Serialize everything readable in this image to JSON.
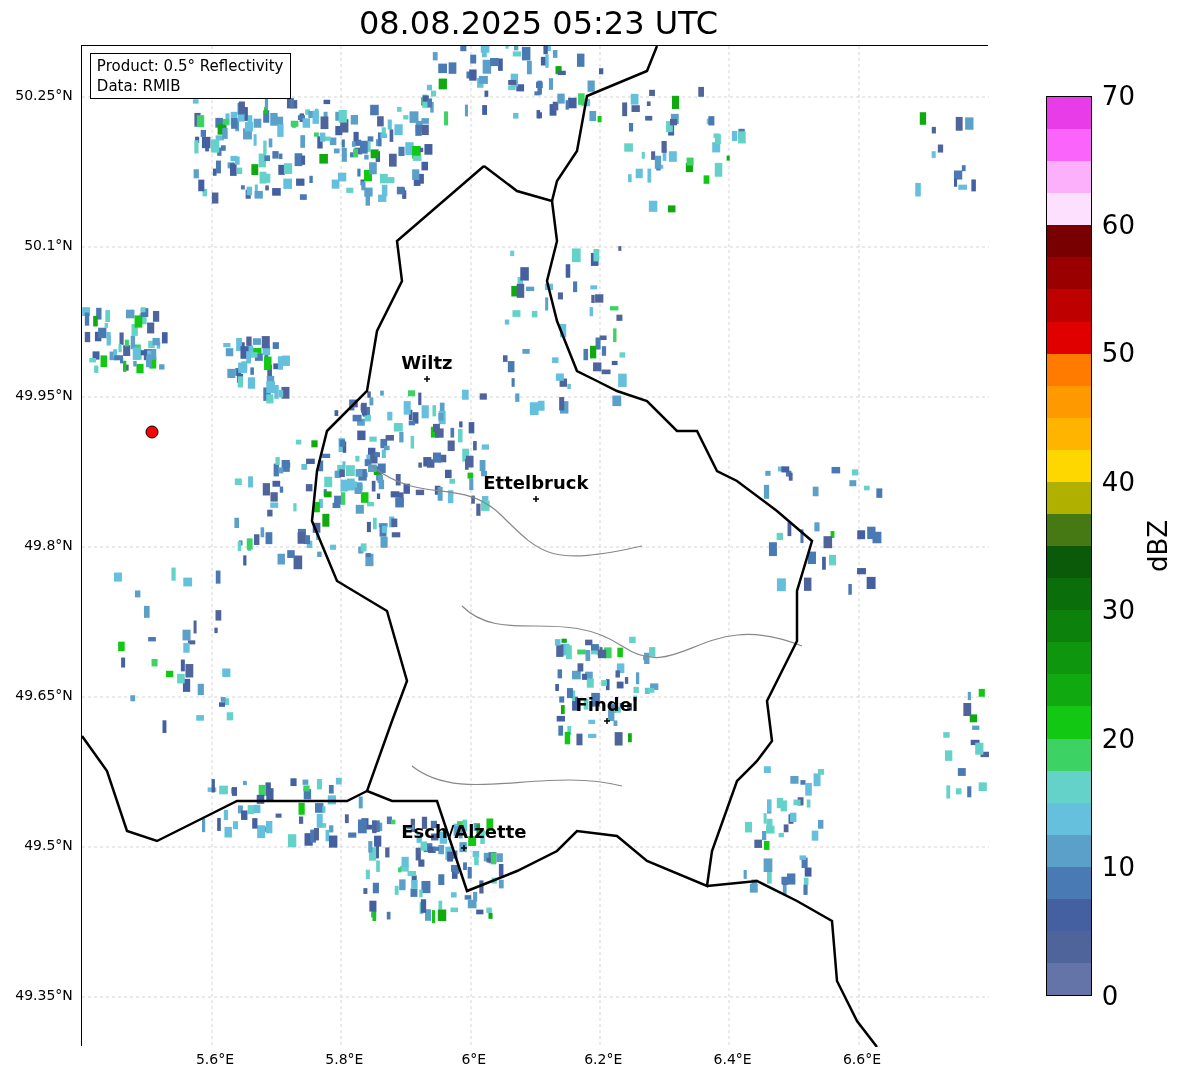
{
  "title": "08.08.2025 05:23 UTC",
  "info_box": [
    "Product: 0.5° Reflectivity",
    "Data: RMIB"
  ],
  "y_ticks": [
    "50.25°N",
    "50.1°N",
    "49.95°N",
    "49.8°N",
    "49.65°N",
    "49.5°N",
    "49.35°N"
  ],
  "x_ticks": [
    "5.6°E",
    "5.8°E",
    "6°E",
    "6.2°E",
    "6.4°E",
    "6.6°E"
  ],
  "cities": [
    {
      "name": "Wiltz"
    },
    {
      "name": "Ettelbruck"
    },
    {
      "name": "Findel"
    },
    {
      "name": "Esch/Alzette"
    }
  ],
  "colorbar": {
    "label": "dBZ",
    "ticks": [
      "70",
      "60",
      "50",
      "40",
      "30",
      "20",
      "10",
      "0"
    ],
    "segments": [
      {
        "color": "#e93ce9"
      },
      {
        "color": "#fa64fa"
      },
      {
        "color": "#fcb0fc"
      },
      {
        "color": "#fde0fd"
      },
      {
        "color": "#780000"
      },
      {
        "color": "#9b0000"
      },
      {
        "color": "#be0000"
      },
      {
        "color": "#e00000"
      },
      {
        "color": "#ff7b00"
      },
      {
        "color": "#ff9900"
      },
      {
        "color": "#ffb400"
      },
      {
        "color": "#ffd700"
      },
      {
        "color": "#b0b000"
      },
      {
        "color": "#467814"
      },
      {
        "color": "#0a5a0a"
      },
      {
        "color": "#0a6e0a"
      },
      {
        "color": "#0c820c"
      },
      {
        "color": "#0e960e"
      },
      {
        "color": "#10aa10"
      },
      {
        "color": "#12c812"
      },
      {
        "color": "#3cd264"
      },
      {
        "color": "#64d2c8"
      },
      {
        "color": "#64c0dc"
      },
      {
        "color": "#5aa0c8"
      },
      {
        "color": "#4a7ab4"
      },
      {
        "color": "#4460a0"
      },
      {
        "color": "#50649c"
      },
      {
        "color": "#6474a8"
      }
    ]
  }
}
